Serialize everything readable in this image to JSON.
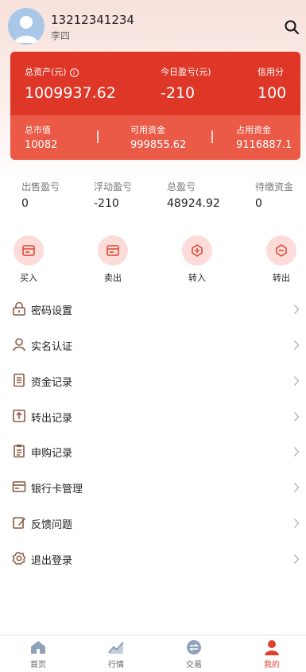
{
  "user": {
    "phone": "13212341234",
    "name": "李四"
  },
  "asset_card": {
    "total_assets_label": "总资产(元)",
    "total_assets_value": "1009937.62",
    "today_pnl_label": "今日盈亏(元)",
    "today_pnl_value": "-210",
    "credit_label": "信用分",
    "credit_value": "100",
    "market_value_label": "总市值",
    "market_value_value": "10082",
    "available_label": "可用资金",
    "available_value": "999855.62",
    "occupied_label": "占用资金",
    "occupied_value": "9116887.1"
  },
  "stats": [
    {
      "label": "出售盈亏",
      "value": "0"
    },
    {
      "label": "浮动盈亏",
      "value": "-210"
    },
    {
      "label": "总盈亏",
      "value": "48924.92"
    },
    {
      "label": "待缴资金",
      "value": "0"
    }
  ],
  "actions": [
    {
      "label": "买入",
      "icon": "card-icon"
    },
    {
      "label": "卖出",
      "icon": "card-icon"
    },
    {
      "label": "转入",
      "icon": "transfer-in-icon"
    },
    {
      "label": "转出",
      "icon": "transfer-out-icon"
    }
  ],
  "menu": [
    {
      "label": "密码设置",
      "icon": "lock-icon"
    },
    {
      "label": "实名认证",
      "icon": "user-icon"
    },
    {
      "label": "资金记录",
      "icon": "list-icon"
    },
    {
      "label": "转出记录",
      "icon": "upload-icon"
    },
    {
      "label": "申购记录",
      "icon": "clipboard-icon"
    },
    {
      "label": "银行卡管理",
      "icon": "bank-card-icon"
    },
    {
      "label": "反馈问题",
      "icon": "edit-icon"
    },
    {
      "label": "退出登录",
      "icon": "gear-icon"
    }
  ],
  "tabbar": [
    {
      "label": "首页",
      "icon": "home-icon",
      "active": false
    },
    {
      "label": "行情",
      "icon": "chart-icon",
      "active": false
    },
    {
      "label": "交易",
      "icon": "exchange-icon",
      "active": false
    },
    {
      "label": "我的",
      "icon": "person-icon",
      "active": true
    }
  ],
  "colors": {
    "brand_red": "#de3728",
    "card_lower": "#ea5a47",
    "icon_brown": "#8a5a44",
    "active_tab": "#e0412f"
  }
}
